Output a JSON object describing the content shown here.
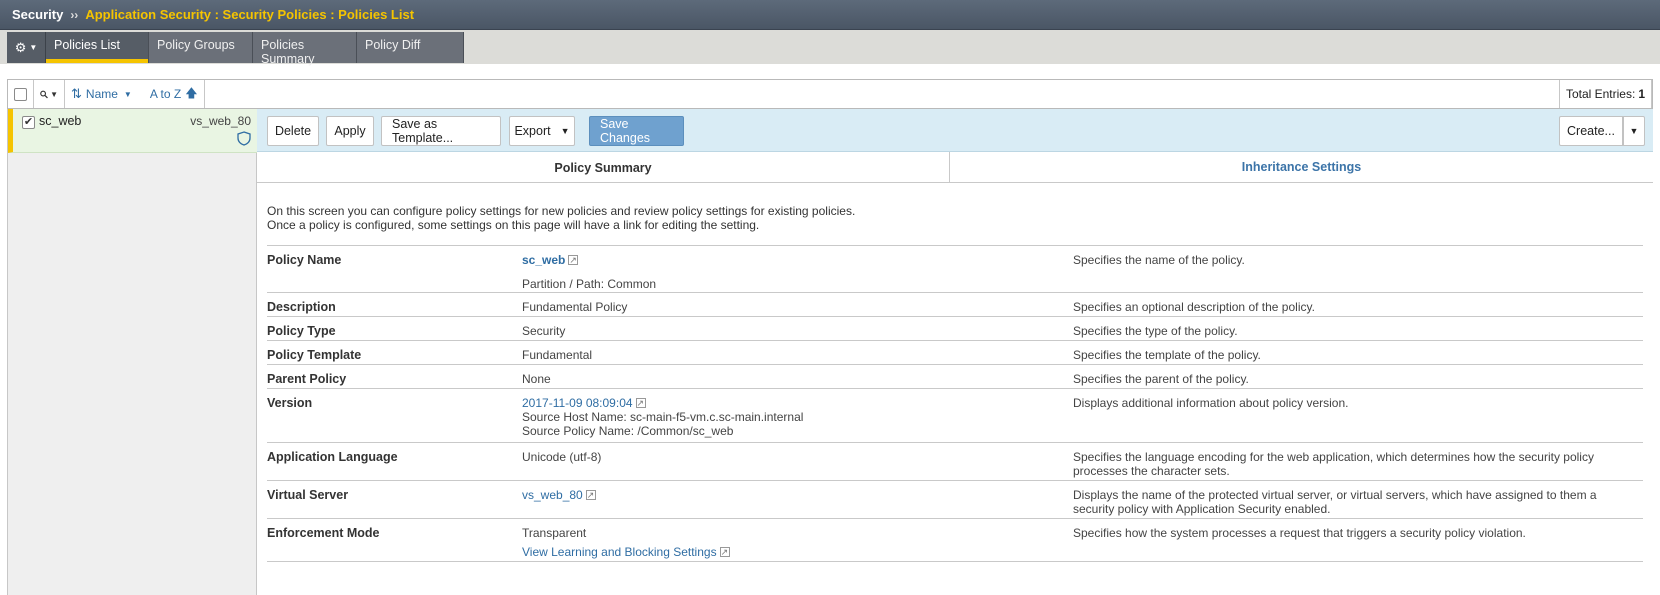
{
  "breadcrumb": {
    "root": "Security",
    "separator": "››",
    "path": "Application Security : Security Policies : Policies List"
  },
  "main_tabs": [
    {
      "label": "Policies List"
    },
    {
      "label": "Policy Groups"
    },
    {
      "label": "Policies Summary"
    },
    {
      "label": "Policy Diff"
    }
  ],
  "list_toolbar": {
    "sort_field": "Name",
    "sort_order": "A to Z",
    "total_label": "Total Entries:",
    "total_value": "1"
  },
  "policy_list": [
    {
      "name": "sc_web",
      "virtual_server": "vs_web_80",
      "checked": true
    }
  ],
  "actions": {
    "delete": "Delete",
    "apply": "Apply",
    "save_template": "Save as Template...",
    "export": "Export",
    "save_changes": "Save Changes",
    "create": "Create..."
  },
  "sub_tabs": {
    "summary": "Policy Summary",
    "inheritance": "Inheritance Settings"
  },
  "intro": {
    "line1": "On this screen you can configure policy settings for new policies and review policy settings for existing policies.",
    "line2": "Once a policy is configured, some settings on this page will have a link for editing the setting."
  },
  "properties": {
    "policy_name": {
      "label": "Policy Name",
      "value": "sc_web",
      "extra": "Partition / Path: Common",
      "desc": "Specifies the name of the policy."
    },
    "description": {
      "label": "Description",
      "value": "Fundamental Policy",
      "desc": "Specifies an optional description of the policy."
    },
    "policy_type": {
      "label": "Policy Type",
      "value": "Security",
      "desc": "Specifies the type of the policy."
    },
    "policy_template": {
      "label": "Policy Template",
      "value": "Fundamental",
      "desc": "Specifies the template of the policy."
    },
    "parent_policy": {
      "label": "Parent Policy",
      "value": "None",
      "desc": "Specifies the parent of the policy."
    },
    "version": {
      "label": "Version",
      "value": "2017-11-09 08:09:04",
      "host": "Source Host Name: sc-main-f5-vm.c.sc-main.internal",
      "source_policy": "Source Policy Name: /Common/sc_web",
      "desc": "Displays additional information about policy version."
    },
    "app_language": {
      "label": "Application Language",
      "value": "Unicode (utf-8)",
      "desc": "Specifies the language encoding for the web application, which determines how the security policy processes the character sets."
    },
    "virtual_server": {
      "label": "Virtual Server",
      "value": "vs_web_80",
      "desc": "Displays the name of the protected virtual server, or virtual servers, which have assigned to them a security policy with Application Security enabled."
    },
    "enforcement_mode": {
      "label": "Enforcement Mode",
      "value": "Transparent",
      "link": "View Learning and Blocking Settings",
      "desc": "Specifies how the system processes a request that triggers a security policy violation."
    }
  },
  "colors": {
    "breadcrumb_path": "#f5c400",
    "active_tab_underline": "#f5c400",
    "action_bar": "#d9ecf5",
    "primary_button": "#6fa1cf",
    "link": "#2f6da3",
    "selected_row": "#e9f5e3"
  },
  "icons": [
    "gear-icon",
    "search-icon",
    "sort-icon",
    "sort-up-arrow-icon",
    "shield-icon",
    "external-link-icon",
    "checkbox-icon"
  ]
}
